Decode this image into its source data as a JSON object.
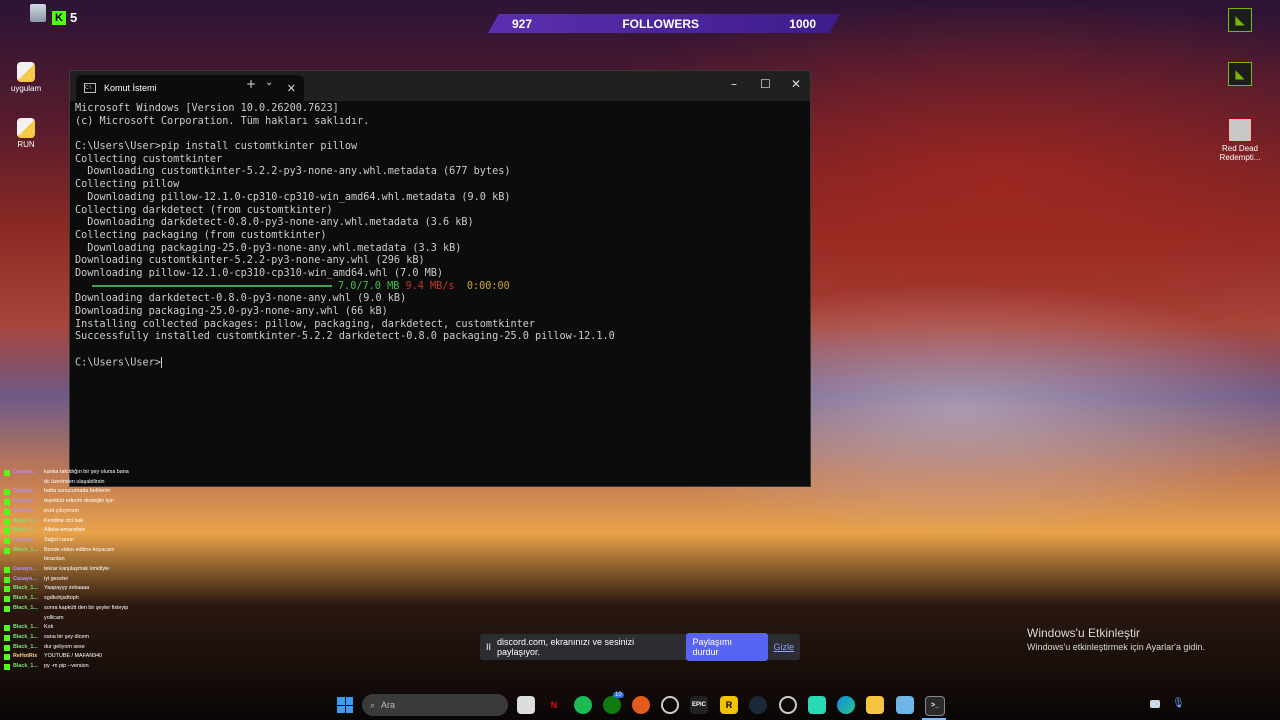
{
  "desktop": {
    "icons_left": [
      {
        "label": "uygulam",
        "icon": "python-script-icon"
      },
      {
        "label": "RUN",
        "icon": "python-script-icon"
      }
    ],
    "icons_right": [
      {
        "label": "",
        "icon": "nvidia-icon"
      },
      {
        "label": "",
        "icon": "nvidia-app-icon"
      },
      {
        "label": "Red Dead Redempti...",
        "icon": "game-shortcut-icon"
      }
    ]
  },
  "kick_counter": {
    "value": "5"
  },
  "followers_widget": {
    "current": "927",
    "label": "FOLLOWERS",
    "goal": "1000"
  },
  "terminal": {
    "tab_title": "Komut İstemi",
    "new_tab": "+",
    "dropdown": "⌄",
    "controls": {
      "minimize": "–",
      "maximize": "☐",
      "close": "✕"
    },
    "lines": [
      "Microsoft Windows [Version 10.0.26200.7623]",
      "(c) Microsoft Corporation. Tüm hakları saklıdır.",
      "",
      "C:\\Users\\User>pip install customtkinter pillow",
      "Collecting customtkinter",
      "  Downloading customtkinter-5.2.2-py3-none-any.whl.metadata (677 bytes)",
      "Collecting pillow",
      "  Downloading pillow-12.1.0-cp310-cp310-win_amd64.whl.metadata (9.0 kB)",
      "Collecting darkdetect (from customtkinter)",
      "  Downloading darkdetect-0.8.0-py3-none-any.whl.metadata (3.6 kB)",
      "Collecting packaging (from customtkinter)",
      "  Downloading packaging-25.0-py3-none-any.whl.metadata (3.3 kB)",
      "Downloading customtkinter-5.2.2-py3-none-any.whl (296 kB)",
      "Downloading pillow-12.1.0-cp310-cp310-win_amd64.whl (7.0 MB)"
    ],
    "progress": {
      "size": "7.0/7.0 MB",
      "speed": "9.4 MB/s",
      "eta": "0:00:00"
    },
    "lines_after": [
      "Downloading darkdetect-0.8.0-py3-none-any.whl (9.0 kB)",
      "Downloading packaging-25.0-py3-none-any.whl (66 kB)",
      "Installing collected packages: pillow, packaging, darkdetect, customtkinter",
      "Successfully installed customtkinter-5.2.2 darkdetect-0.8.0 packaging-25.0 pillow-12.1.0",
      "",
      "C:\\Users\\User>"
    ]
  },
  "chat": [
    {
      "user": "Casayo...",
      "msg": "kanka takıldığın bir şey olursa bana dc üzerinden ulaşabilirsin",
      "color": "#b58cff"
    },
    {
      "user": "Casayo...",
      "msg": "hatta sunucumada beklerim",
      "color": "#b58cff"
    },
    {
      "user": "Casayo...",
      "msg": "teşekkür ederim desteğin için",
      "color": "#b58cff"
    },
    {
      "user": "Casayo...",
      "msg": "evet çıkıyorum",
      "color": "#b58cff"
    },
    {
      "user": "Black_1...",
      "msg": "Kendine cici bak",
      "color": "#7fe07f"
    },
    {
      "user": "Black_1...",
      "msg": "Allaha emanetsin",
      "color": "#7fe07f"
    },
    {
      "user": "Casayo...",
      "msg": "Sağol canım",
      "color": "#b58cff"
    },
    {
      "user": "Black_1...",
      "msg": "Bende video editine koyacam birazdan",
      "color": "#7fe07f"
    },
    {
      "user": "Casayo...",
      "msg": "tekrar karşılaşmak ümidiyle",
      "color": "#b58cff"
    },
    {
      "user": "Casayo...",
      "msg": "iyi geceler",
      "color": "#b58cff"
    },
    {
      "user": "Black_1...",
      "msg": "Yaapayyy zekaaaa",
      "color": "#7fe07f"
    },
    {
      "user": "Black_1...",
      "msg": "sgdkohjsdtoph",
      "color": "#7fe07f"
    },
    {
      "user": "Black_1...",
      "msg": "sonra kapkütt den bir şeyler fixleyip yollicam",
      "color": "#7fe07f"
    },
    {
      "user": "Black_1...",
      "msg": "Kok",
      "color": "#7fe07f"
    },
    {
      "user": "Black_1...",
      "msg": "sana bir şey dicem",
      "color": "#7fe07f"
    },
    {
      "user": "Black_1...",
      "msg": "dur geliyom sese",
      "color": "#7fe07f"
    },
    {
      "user": "ReHotRix",
      "msg": "YOUTUBE / MAFAN940",
      "color": "#ffd27f"
    },
    {
      "user": "Black_1...",
      "msg": "py -m pip --version",
      "color": "#7fe07f"
    }
  ],
  "share_bar": {
    "pause": "II",
    "text": "discord.com, ekranınızı ve sesinizi paylaşıyor.",
    "stop": "Paylaşımı durdur",
    "hide": "Gizle"
  },
  "activation": {
    "title": "Windows'u Etkinleştir",
    "subtitle": "Windows'u etkinleştirmek için Ayarlar'a gidin."
  },
  "taskbar": {
    "search_placeholder": "Ara",
    "xbox_badge": "10"
  }
}
